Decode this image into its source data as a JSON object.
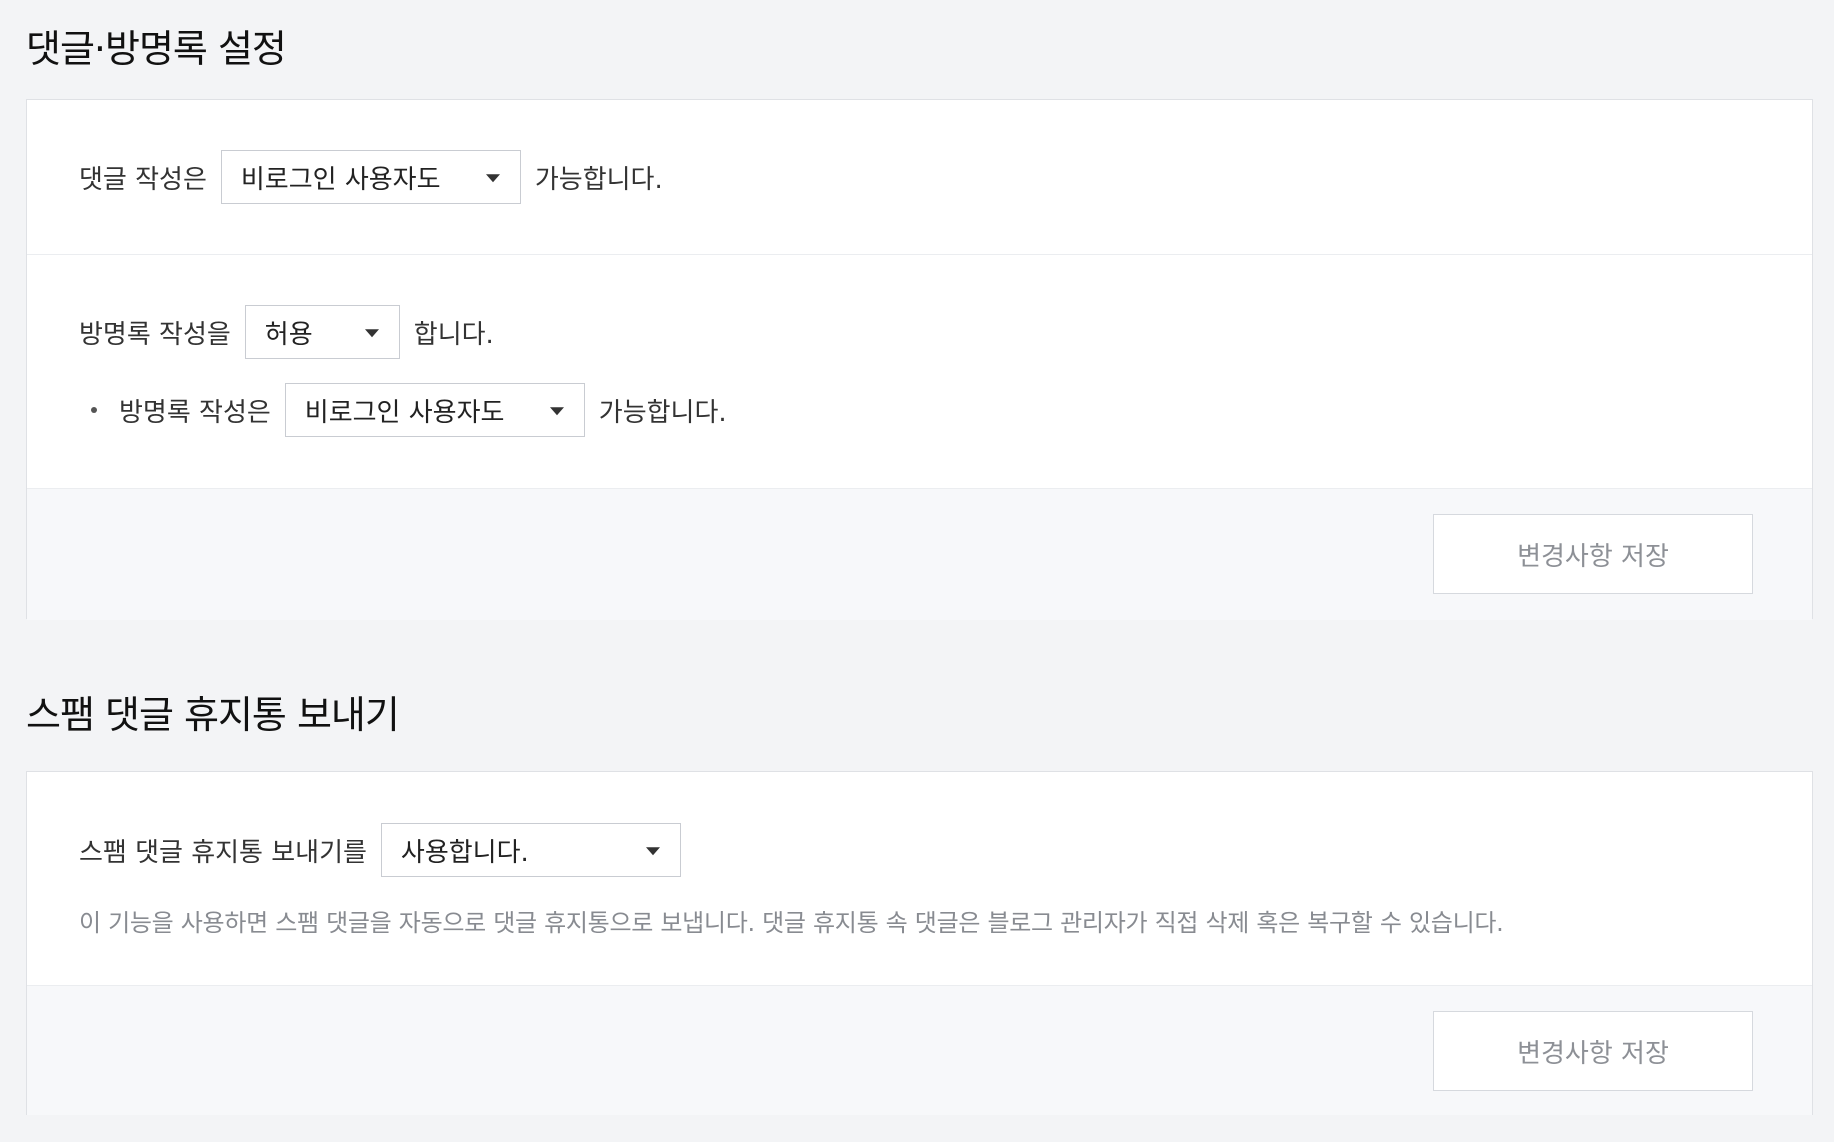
{
  "comments_guestbook": {
    "title": "댓글·방명록 설정",
    "comment_write": {
      "prefix": "댓글 작성은",
      "selected": "비로그인 사용자도",
      "suffix": "가능합니다."
    },
    "guestbook_write": {
      "prefix": "방명록 작성을",
      "selected": "허용",
      "suffix": "합니다."
    },
    "guestbook_who": {
      "prefix": "방명록 작성은",
      "selected": "비로그인 사용자도",
      "suffix": "가능합니다."
    },
    "save_label": "변경사항 저장"
  },
  "spam": {
    "title": "스팸 댓글 휴지통 보내기",
    "prefix": "스팸 댓글 휴지통 보내기를",
    "selected": "사용합니다.",
    "description": "이 기능을 사용하면 스팸 댓글을 자동으로 댓글 휴지통으로 보냅니다. 댓글 휴지통 속 댓글은 블로그 관리자가 직접 삭제 혹은 복구할 수 있습니다.",
    "save_label": "변경사항 저장"
  },
  "icons": {
    "dropdown": "caret-down-icon",
    "bullet": "bullet-dot"
  }
}
